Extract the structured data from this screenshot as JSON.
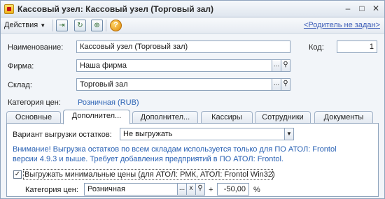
{
  "window": {
    "title": "Кассовый узел: Кассовый узел (Торговый зал)"
  },
  "toolbar": {
    "actions_label": "Действия",
    "parent_link": "<Родитель не задан>"
  },
  "form": {
    "name_label": "Наименование:",
    "name_value": "Кассовый узел (Торговый зал)",
    "code_label": "Код:",
    "code_value": "1",
    "firm_label": "Фирма:",
    "firm_value": "Наша фирма",
    "warehouse_label": "Склад:",
    "warehouse_value": "Торговый зал",
    "price_category_label": "Категория цен:",
    "price_category_value": "Розничная (RUB)"
  },
  "tabs": [
    {
      "label": "Основные",
      "active": false
    },
    {
      "label": "Дополнител...",
      "active": true
    },
    {
      "label": "Дополнител...",
      "active": false
    },
    {
      "label": "Кассиры",
      "active": false
    },
    {
      "label": "Сотрудники",
      "active": false
    },
    {
      "label": "Документы",
      "active": false
    }
  ],
  "panel": {
    "export_variant_label": "Вариант выгрузки остатков:",
    "export_variant_value": "Не выгружать",
    "notice_line1": "Внимание! Выгрузка остатков по всем складам используется только для ПО АТОЛ: Frontol",
    "notice_line2": "версии 4.9.3 и выше. Требует добавления предприятий в ПО АТОЛ: Frontol.",
    "min_prices_checkbox_label": "Выгружать минимальные цены (для АТОЛ: РМК, АТОЛ: Frontol Win32)",
    "min_prices_checked": true,
    "min_price_category_label": "Категория цен:",
    "min_price_category_value": "Розничная",
    "plus_sign": "+",
    "percent_value": "-50,00",
    "percent_sign": "%"
  },
  "icons": {
    "select_button": "...",
    "search_button": "search-icon",
    "clear_button": "x"
  }
}
